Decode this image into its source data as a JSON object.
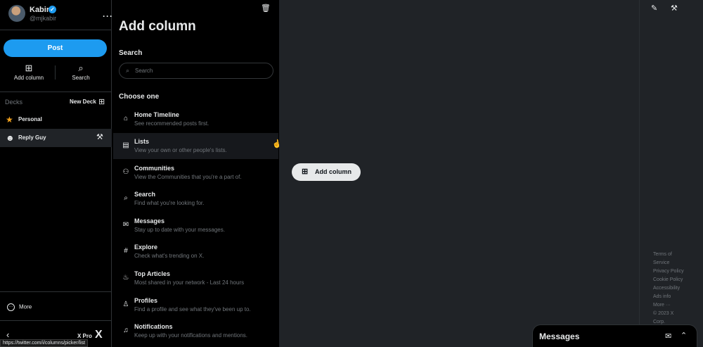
{
  "profile": {
    "name": "Kabir",
    "handle": "@mjkabir",
    "verified_mark": "✓",
    "more": "···"
  },
  "sidebar": {
    "post_label": "Post",
    "quick_actions": [
      {
        "label": "Add column",
        "icon": "add-column-icon",
        "glyph": "⊞"
      },
      {
        "label": "Search",
        "icon": "search-icon",
        "glyph": "⌕"
      }
    ],
    "decks_heading": "Decks",
    "new_deck_label": "New Deck",
    "decks": [
      {
        "label": "Personal",
        "icon": "star-icon",
        "glyph": "★",
        "color": "#f4a31d"
      },
      {
        "label": "Reply Guy",
        "icon": "reply-guy-icon",
        "glyph": "☻",
        "color": "#e7e9ea",
        "active": true
      }
    ],
    "more_label": "More",
    "xpro_label": "X Pro",
    "x_logo": "X"
  },
  "status_url": "https://twitter.com/i/columns/picker/list",
  "panel": {
    "title": "Add column",
    "search_heading": "Search",
    "search_placeholder": "Search",
    "choose_heading": "Choose one",
    "options": [
      {
        "title": "Home Timeline",
        "desc": "See recommended posts first.",
        "icon": "home-icon",
        "glyph": "⌂"
      },
      {
        "title": "Lists",
        "desc": "View your own or other people's lists.",
        "icon": "list-icon",
        "glyph": "▤",
        "hovered": true
      },
      {
        "title": "Communities",
        "desc": "View the Communities that you're a part of.",
        "icon": "communities-icon",
        "glyph": "⚇"
      },
      {
        "title": "Search",
        "desc": "Find what you're looking for.",
        "icon": "search-icon",
        "glyph": "⌕"
      },
      {
        "title": "Messages",
        "desc": "Stay up to date with your messages.",
        "icon": "envelope-icon",
        "glyph": "✉"
      },
      {
        "title": "Explore",
        "desc": "Check what's trending on X.",
        "icon": "hashtag-icon",
        "glyph": "#"
      },
      {
        "title": "Top Articles",
        "desc": "Most shared in your network - Last 24 hours",
        "icon": "flame-icon",
        "glyph": "♨"
      },
      {
        "title": "Profiles",
        "desc": "Find a profile and see what they've been up to.",
        "icon": "person-icon",
        "glyph": "♙"
      },
      {
        "title": "Notifications",
        "desc": "Keep up with your notifications and mentions.",
        "icon": "bell-icon",
        "glyph": "♫"
      }
    ]
  },
  "main": {
    "add_column_label": "Add column"
  },
  "footer": {
    "links": [
      "Terms of",
      "Service",
      "Privacy Policy",
      "Cookie Policy",
      "Accessibility",
      "Ads info",
      "More ···",
      "© 2023 X",
      "Corp."
    ]
  },
  "messages": {
    "title": "Messages"
  },
  "colors": {
    "accent": "#1d9bf0",
    "background": "#000000",
    "column_bg": "#202327",
    "muted_text": "#71767b"
  }
}
